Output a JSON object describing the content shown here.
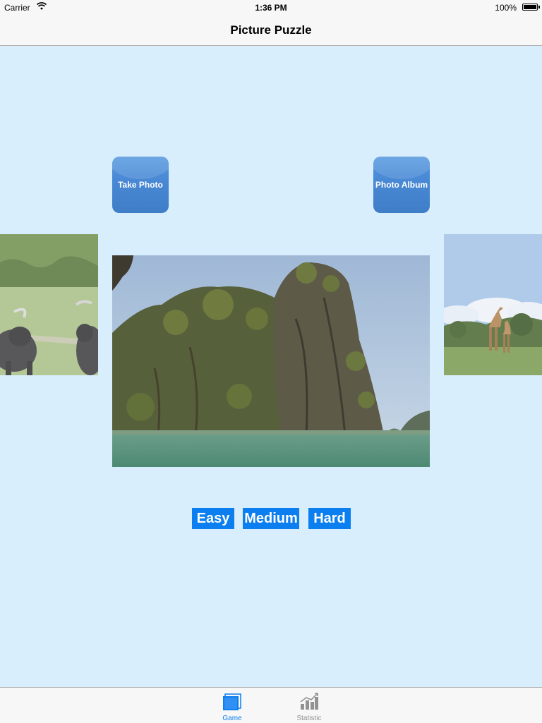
{
  "status_bar": {
    "carrier": "Carrier",
    "time": "1:36 PM",
    "battery": "100%"
  },
  "nav": {
    "title": "Picture Puzzle"
  },
  "buttons": {
    "take_photo": "Take Photo",
    "photo_album": "Photo Album"
  },
  "carousel": {
    "left_image": "buffalo-photo",
    "center_image": "limestone-island-photo",
    "right_image": "giraffe-photo"
  },
  "difficulty": {
    "easy": "Easy",
    "medium": "Medium",
    "hard": "Hard"
  },
  "tab_bar": {
    "tabs": [
      {
        "label": "Game",
        "icon": "game-icon",
        "selected": true
      },
      {
        "label": "Statistic",
        "icon": "statistic-icon",
        "selected": false
      }
    ]
  },
  "colors": {
    "background": "#d9eefd",
    "accent": "#0b7ef0",
    "photo_button": "#4a8ad6",
    "tab_inactive": "#929292"
  }
}
